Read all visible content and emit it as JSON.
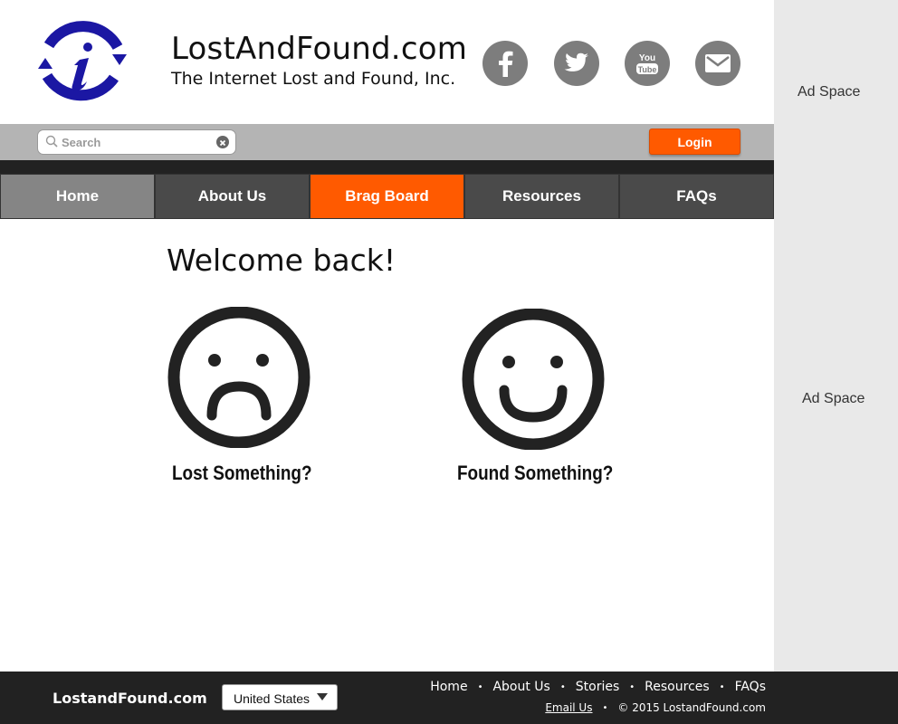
{
  "colors": {
    "accent": "#ff5a00",
    "logo_blue": "#1b17a3",
    "nav_dark": "#4a4a4a",
    "footer_bg": "#222222",
    "ad_bg": "#e9e9e9"
  },
  "header": {
    "site_title": "LostAndFound.com",
    "tagline": "The Internet Lost and Found, Inc.",
    "logo_icon": "info-i-logo",
    "social": [
      {
        "name": "facebook",
        "icon": "facebook-icon"
      },
      {
        "name": "twitter",
        "icon": "twitter-icon"
      },
      {
        "name": "youtube",
        "icon": "youtube-icon"
      },
      {
        "name": "email",
        "icon": "mail-icon"
      }
    ]
  },
  "search": {
    "placeholder": "Search",
    "value": ""
  },
  "login": {
    "label": "Login"
  },
  "nav": {
    "items": [
      {
        "label": "Home",
        "state": "home"
      },
      {
        "label": "About Us",
        "state": "default"
      },
      {
        "label": "Brag Board",
        "state": "active"
      },
      {
        "label": "Resources",
        "state": "default"
      },
      {
        "label": "FAQs",
        "state": "default"
      }
    ]
  },
  "main": {
    "welcome": "Welcome back!",
    "lost_label": "Lost Something?",
    "found_label": "Found Something?"
  },
  "ads": {
    "top": "Ad Space",
    "middle": "Ad Space"
  },
  "footer": {
    "brand": "LostandFound.com",
    "country": "United States",
    "links": [
      "Home",
      "About Us",
      "Stories",
      "Resources",
      "FAQs"
    ],
    "email_link": "Email Us",
    "copyright": "© 2015 LostandFound.com"
  }
}
